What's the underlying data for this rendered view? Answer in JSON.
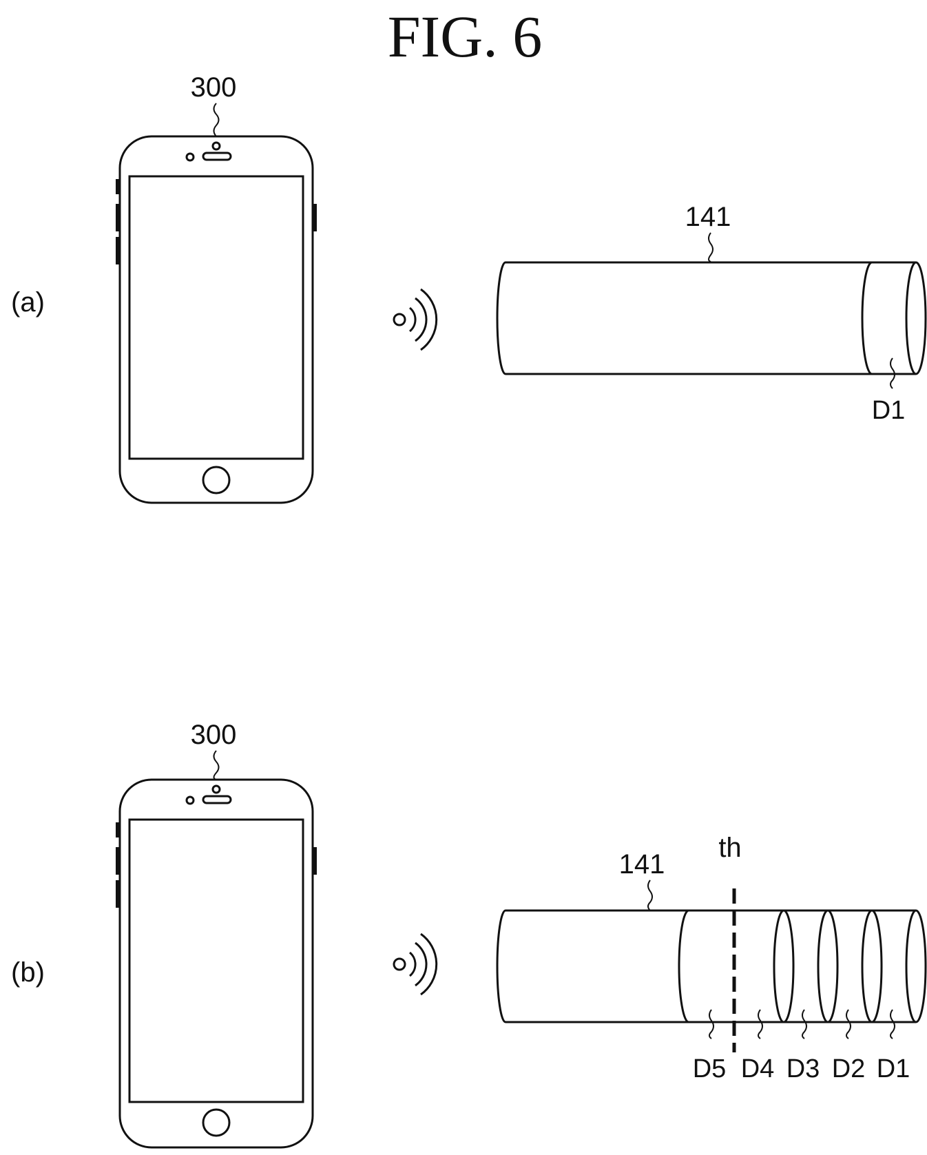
{
  "figure": {
    "title": "FIG. 6"
  },
  "panels": [
    {
      "panel_label": "(a)",
      "phone_label": "300",
      "tube_label": "141",
      "threshold_label": "",
      "segments": [
        "D1"
      ]
    },
    {
      "panel_label": "(b)",
      "phone_label": "300",
      "tube_label": "141",
      "threshold_label": "th",
      "segments": [
        "D5",
        "D4",
        "D3",
        "D2",
        "D1"
      ]
    }
  ]
}
